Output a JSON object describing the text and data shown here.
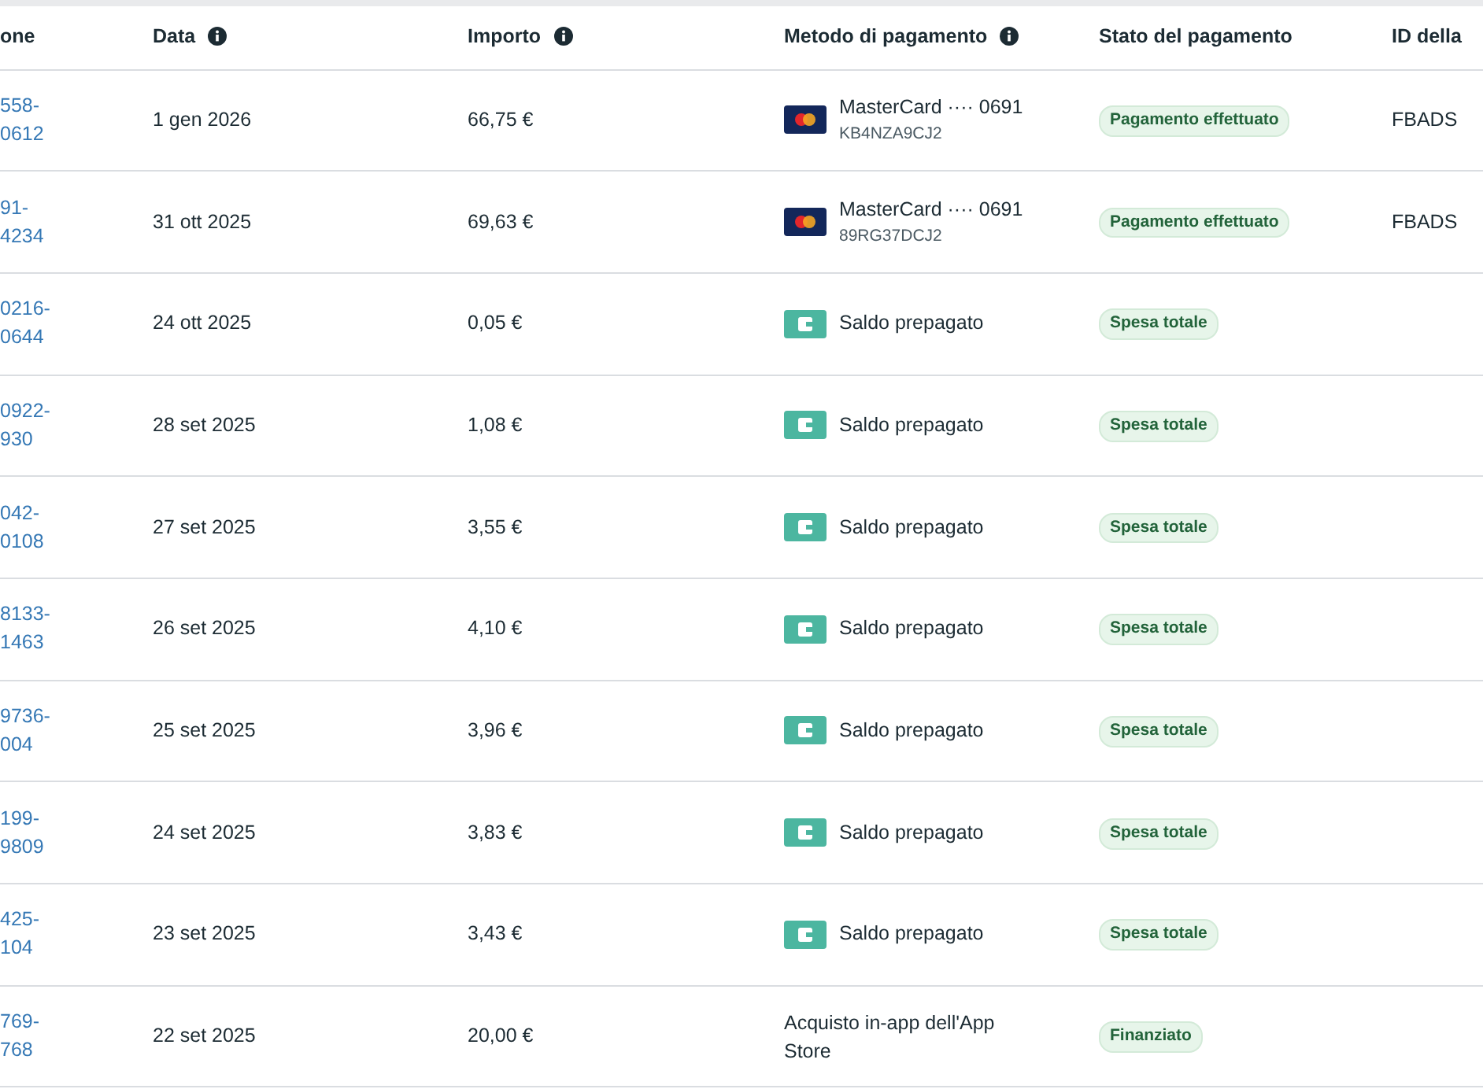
{
  "table": {
    "columns": [
      {
        "label": "one",
        "info": false
      },
      {
        "label": "Data",
        "info": true
      },
      {
        "label": "Importo",
        "info": true
      },
      {
        "label": "Metodo di pagamento",
        "info": true
      },
      {
        "label": "Stato del pagamento",
        "info": false
      },
      {
        "label": "ID della",
        "info": false
      }
    ],
    "rows": [
      {
        "id_lines": [
          "558-",
          "0612"
        ],
        "date": "1 gen 2026",
        "amount": "66,75 €",
        "method": {
          "kind": "card",
          "label": "MasterCard ···· 0691",
          "code": "KB4NZA9CJ2"
        },
        "status": "Pagamento effettuato",
        "column_6": "FBADS"
      },
      {
        "id_lines": [
          "91-",
          "4234"
        ],
        "date": "31 ott 2025",
        "amount": "69,63 €",
        "method": {
          "kind": "card",
          "label": "MasterCard ···· 0691",
          "code": "89RG37DCJ2"
        },
        "status": "Pagamento effettuato",
        "column_6": "FBADS"
      },
      {
        "id_lines": [
          "0216-",
          "0644"
        ],
        "date": "24 ott 2025",
        "amount": "0,05 €",
        "method": {
          "kind": "wallet",
          "label": "Saldo prepagato"
        },
        "status": "Spesa totale"
      },
      {
        "id_lines": [
          "0922-",
          "930"
        ],
        "date": "28 set 2025",
        "amount": "1,08 €",
        "method": {
          "kind": "wallet",
          "label": "Saldo prepagato"
        },
        "status": "Spesa totale"
      },
      {
        "id_lines": [
          "042-",
          "0108"
        ],
        "date": "27 set 2025",
        "amount": "3,55 €",
        "method": {
          "kind": "wallet",
          "label": "Saldo prepagato"
        },
        "status": "Spesa totale"
      },
      {
        "id_lines": [
          "8133-",
          "1463"
        ],
        "date": "26 set 2025",
        "amount": "4,10 €",
        "method": {
          "kind": "wallet",
          "label": "Saldo prepagato"
        },
        "status": "Spesa totale"
      },
      {
        "id_lines": [
          "9736-",
          "004"
        ],
        "date": "25 set 2025",
        "amount": "3,96 €",
        "method": {
          "kind": "wallet",
          "label": "Saldo prepagato"
        },
        "status": "Spesa totale"
      },
      {
        "id_lines": [
          "199-",
          "9809"
        ],
        "date": "24 set 2025",
        "amount": "3,83 €",
        "method": {
          "kind": "wallet",
          "label": "Saldo prepagato"
        },
        "status": "Spesa totale"
      },
      {
        "id_lines": [
          "425-",
          "104"
        ],
        "date": "23 set 2025",
        "amount": "3,43 €",
        "method": {
          "kind": "wallet",
          "label": "Saldo prepagato"
        },
        "status": "Spesa totale"
      },
      {
        "id_lines": [
          "769-",
          "768"
        ],
        "date": "22 set 2025",
        "amount": "20,00 €",
        "method": {
          "kind": "text",
          "label": "Acquisto in-app dell'App Store"
        },
        "status": "Finanziato"
      }
    ]
  }
}
